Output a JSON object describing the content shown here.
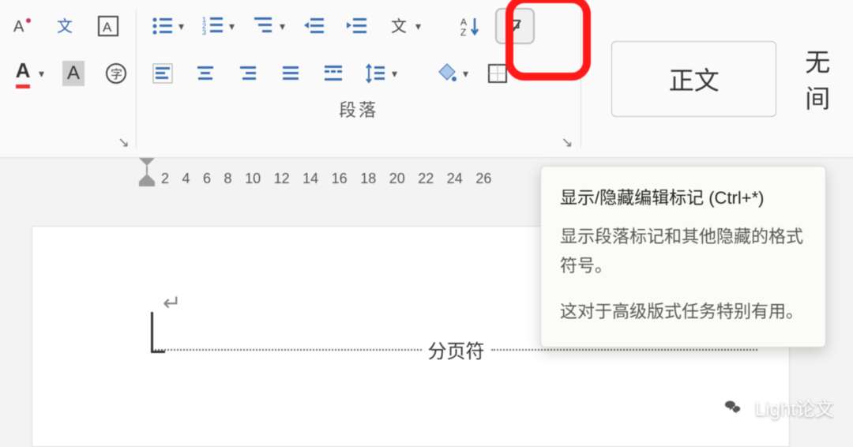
{
  "ribbon": {
    "font": {
      "phoneticGuide": "拼音指南",
      "charBorder": "字符边框",
      "charBox": "带圈字符(A)",
      "fontColor": "字体颜色",
      "highlight": "文本高亮",
      "enclosed": "带圈字符"
    },
    "paragraph": {
      "label": "段落",
      "bullets": "项目符号",
      "numbering": "编号",
      "multilevel": "多级列表",
      "decIndent": "减少缩进",
      "incIndent": "增加缩进",
      "asianLayout": "中文版式",
      "alignLeft": "左对齐",
      "alignCenter": "居中",
      "alignRight": "右对齐",
      "justify": "两端对齐",
      "distribute": "分散对齐",
      "lineSpacing": "行距",
      "shading": "底纹",
      "borders": "边框",
      "sort": "排序",
      "showMarks": "显示/隐藏编辑标记"
    },
    "styles": {
      "normal": "正文",
      "noSpacing": "无间"
    }
  },
  "ruler": {
    "ticks": [
      "2",
      "4",
      "6",
      "8",
      "10",
      "12",
      "14",
      "16",
      "18",
      "20",
      "22",
      "24",
      "26"
    ]
  },
  "document": {
    "pageBreakLabel": "分页符"
  },
  "tooltip": {
    "title": "显示/隐藏编辑标记 (Ctrl+*)",
    "body1": "显示段落标记和其他隐藏的格式符号。",
    "body2": "这对于高级版式任务特别有用。"
  },
  "watermark": {
    "text": "Light论文"
  }
}
